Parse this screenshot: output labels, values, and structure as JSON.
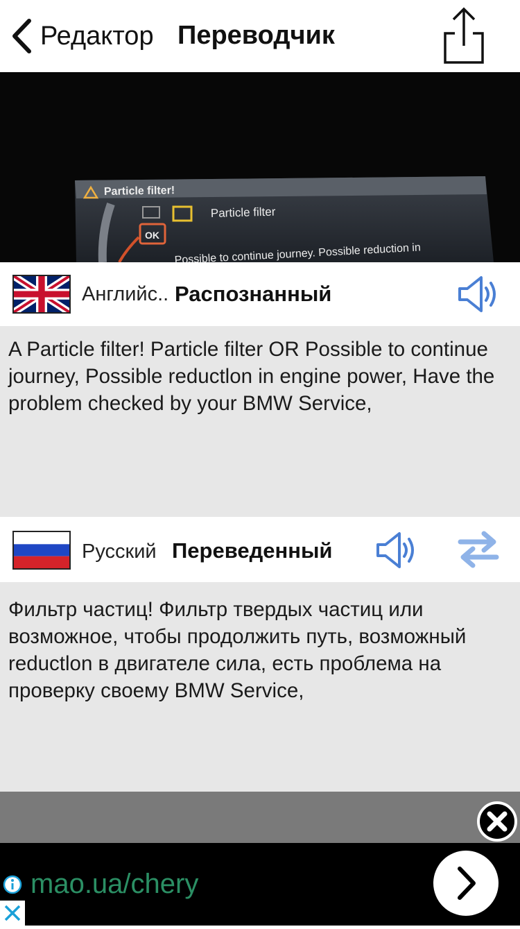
{
  "nav": {
    "back_label": "Редактор",
    "title": "Переводчик"
  },
  "photo": {
    "warning_title": "Particle filter!",
    "ok_label": "OK",
    "panel_heading": "Particle filter",
    "panel_line1": "Possible to continue journey. Possible reduction in",
    "panel_line2": "Possible to continue journey. Possible reduction in engine power. Have the problem checked by your BMW"
  },
  "source": {
    "language": "Английс..",
    "status": "Распознанный",
    "flag_icon": "uk-flag-icon",
    "text": "A Particle filter! Particle filter OR Possible to continue journey, Possible reductlon in engine power, Have the problem checked by your BMW Service,"
  },
  "target": {
    "language": "Русский",
    "status": "Переведенный",
    "flag_icon": "russia-flag-icon",
    "text": "Фильтр частиц!  Фильтр твердых частиц или возможное, чтобы продолжить путь, возможный reductlon в двигателе  сила, есть проблема на проверку своему BMW Service,"
  },
  "ad": {
    "url": "mao.ua/chery",
    "url_color": "#2b8f64"
  },
  "colors": {
    "accent": "#4a7fd4",
    "swap": "#8fb3e8",
    "panel": "#e7e7e7"
  }
}
